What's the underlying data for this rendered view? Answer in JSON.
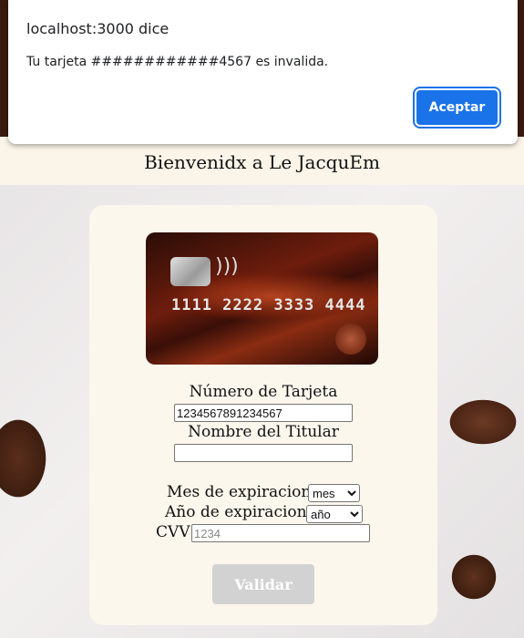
{
  "dialog": {
    "origin": "localhost:3000 dice",
    "message": "Tu tarjeta ############4567 es invalida.",
    "accept_label": "Aceptar"
  },
  "page": {
    "title": "Bienvenidx a Le JacquEm"
  },
  "card_image": {
    "number": "1111 2222 3333 4444"
  },
  "form": {
    "card_number_label": "Número de Tarjeta",
    "card_number_value": "1234567891234567",
    "holder_label": "Nombre del Titular",
    "holder_value": "",
    "month_label": "Mes de expiracion",
    "month_value": "mes",
    "year_label": "Año de expiracion",
    "year_value": "año",
    "cvv_label": "CVV",
    "cvv_placeholder": "1234",
    "validate_label": "Validar"
  },
  "colors": {
    "accent": "#1a73e8",
    "card_bg": "#fcf7ed",
    "button_disabled": "#d2d2d2"
  }
}
